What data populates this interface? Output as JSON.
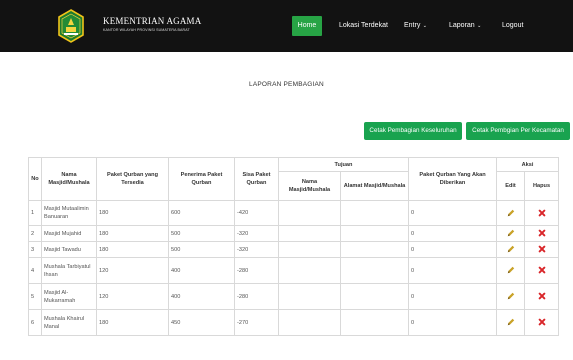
{
  "header": {
    "title": "KEMENTRIAN AGAMA",
    "subtitle": "KANTOR WILAYAH PROVINSI SUMATERA BARAT",
    "nav": {
      "home": "Home",
      "lokasi": "Lokasi Terdekat",
      "entry": "Entry",
      "laporan": "Laporan",
      "logout": "Logout"
    },
    "colors": {
      "navbar": "#121212",
      "active": "#27a445"
    }
  },
  "page": {
    "title": "LAPORAN PEMBAGIAN"
  },
  "actions": {
    "cetak_all": "Cetak Pembagian Keseluruhan",
    "cetak_kecamatan": "Cetak Pembgian Per Kecamatan",
    "color": "#19a34f"
  },
  "table": {
    "headers": {
      "no": "No",
      "nama": "Nama Masjid/Mushala",
      "paket_tersedia": "Paket Qurban yang Tersedia",
      "penerima": "Penerima Paket Qurban",
      "sisa": "Sisa Paket Qurban",
      "tujuan": "Tujuan",
      "tujuan_nama": "Nama Masjid/Mushala",
      "tujuan_alamat": "Alamat Masjid/Mushala",
      "akan_diberikan": "Paket Qurban Yang Akan Diberikan",
      "aksi": "Aksi",
      "edit": "Edit",
      "hapus": "Hapus"
    },
    "rows": [
      {
        "no": "1",
        "nama": "Masjid Mutaalimin Banuaran",
        "tersedia": "180",
        "penerima": "600",
        "sisa": "-420",
        "tujuan_nama": "",
        "tujuan_alamat": "",
        "diberikan": "0"
      },
      {
        "no": "2",
        "nama": "Masjid Mujahid",
        "tersedia": "180",
        "penerima": "500",
        "sisa": "-320",
        "tujuan_nama": "",
        "tujuan_alamat": "",
        "diberikan": "0"
      },
      {
        "no": "3",
        "nama": "Masjid Tawadu",
        "tersedia": "180",
        "penerima": "500",
        "sisa": "-320",
        "tujuan_nama": "",
        "tujuan_alamat": "",
        "diberikan": "0"
      },
      {
        "no": "4",
        "nama": "Mushala Tarbiyatul Ihsan",
        "tersedia": "120",
        "penerima": "400",
        "sisa": "-280",
        "tujuan_nama": "",
        "tujuan_alamat": "",
        "diberikan": "0"
      },
      {
        "no": "5",
        "nama": "Masjid Al-Mukarramah",
        "tersedia": "120",
        "penerima": "400",
        "sisa": "-280",
        "tujuan_nama": "",
        "tujuan_alamat": "",
        "diberikan": "0"
      },
      {
        "no": "6",
        "nama": "Mushala Khairul Manal",
        "tersedia": "180",
        "penerima": "450",
        "sisa": "-270",
        "tujuan_nama": "",
        "tujuan_alamat": "",
        "diberikan": "0"
      }
    ],
    "icons": {
      "edit": "pencil-icon",
      "hapus": "delete-icon"
    },
    "icon_colors": {
      "edit": "#c9a227",
      "hapus": "#d9262a"
    }
  }
}
